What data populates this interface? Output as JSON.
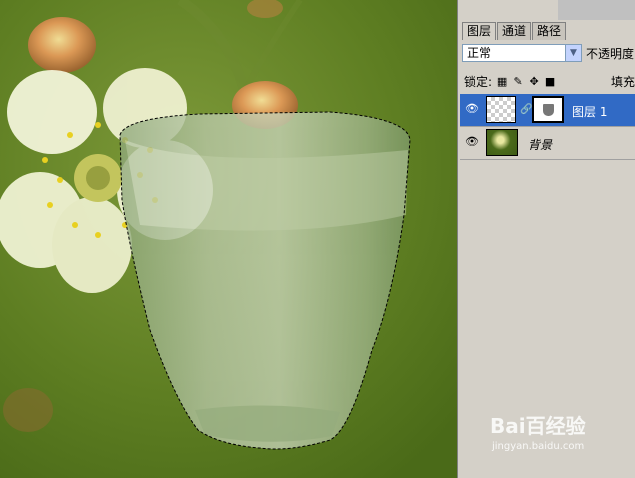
{
  "panel": {
    "tabs": [
      {
        "label": "图层",
        "active": true
      },
      {
        "label": "通道",
        "active": false
      },
      {
        "label": "路径",
        "active": false
      }
    ],
    "blend_mode": "正常",
    "opacity_label": "不透明度",
    "lock_label": "锁定:",
    "fill_label": "填充",
    "layers": [
      {
        "name": "图层 1",
        "selected": true,
        "visible": true
      },
      {
        "name": "背景",
        "selected": false,
        "visible": true
      }
    ]
  },
  "watermark": {
    "brand": "Bai百经验",
    "url": "jingyan.baidu.com"
  },
  "colors": {
    "selection": "#316ac5",
    "panel_bg": "#d4d0c8",
    "canvas_bg": "#5a7a20"
  }
}
